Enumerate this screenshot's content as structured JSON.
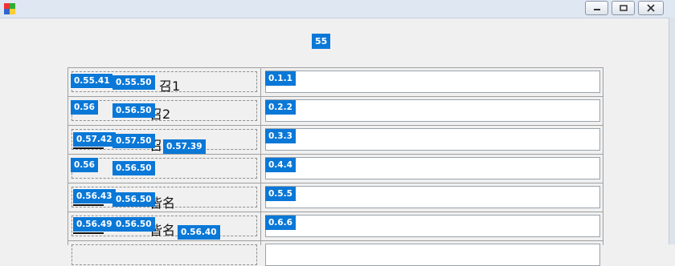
{
  "window": {
    "buttons": [
      "minimize",
      "maximize",
      "close"
    ]
  },
  "header_badge": "55",
  "rows": [
    {
      "left_badges": [
        "0.55.41",
        "0.55.50"
      ],
      "label_tail": "召1",
      "extra_badge": "",
      "extra_tail": "",
      "value_badge": "0.1.1"
    },
    {
      "left_badges": [
        "0.56",
        "0.56.50"
      ],
      "label_tail": "召2",
      "extra_badge": "",
      "extra_tail": "",
      "value_badge": "0.2.2"
    },
    {
      "left_badges": [
        "0.57.42",
        "0.57.50"
      ],
      "label_tail": "召",
      "extra_badge": "0.57.39",
      "extra_tail": "）",
      "value_badge": "0.3.3"
    },
    {
      "left_badges": [
        "0.56",
        "0.56.50"
      ],
      "label_tail": "",
      "extra_badge": "",
      "extra_tail": "",
      "value_badge": "0.4.4"
    },
    {
      "left_badges": [
        "0.56.43",
        "0.56.50"
      ],
      "label_tail": "皆名",
      "extra_badge": "",
      "extra_tail": "",
      "value_badge": "0.5.5"
    },
    {
      "left_badges": [
        "0.56.49",
        "0.56.50"
      ],
      "label_tail": "皆名",
      "extra_badge": "0.56.40",
      "extra_tail": "）",
      "value_badge": "0.6.6"
    }
  ],
  "colors": {
    "badge": "#0a78d7",
    "window_bg": "#f0f0f0",
    "titlebar": "#dfe7f2"
  }
}
